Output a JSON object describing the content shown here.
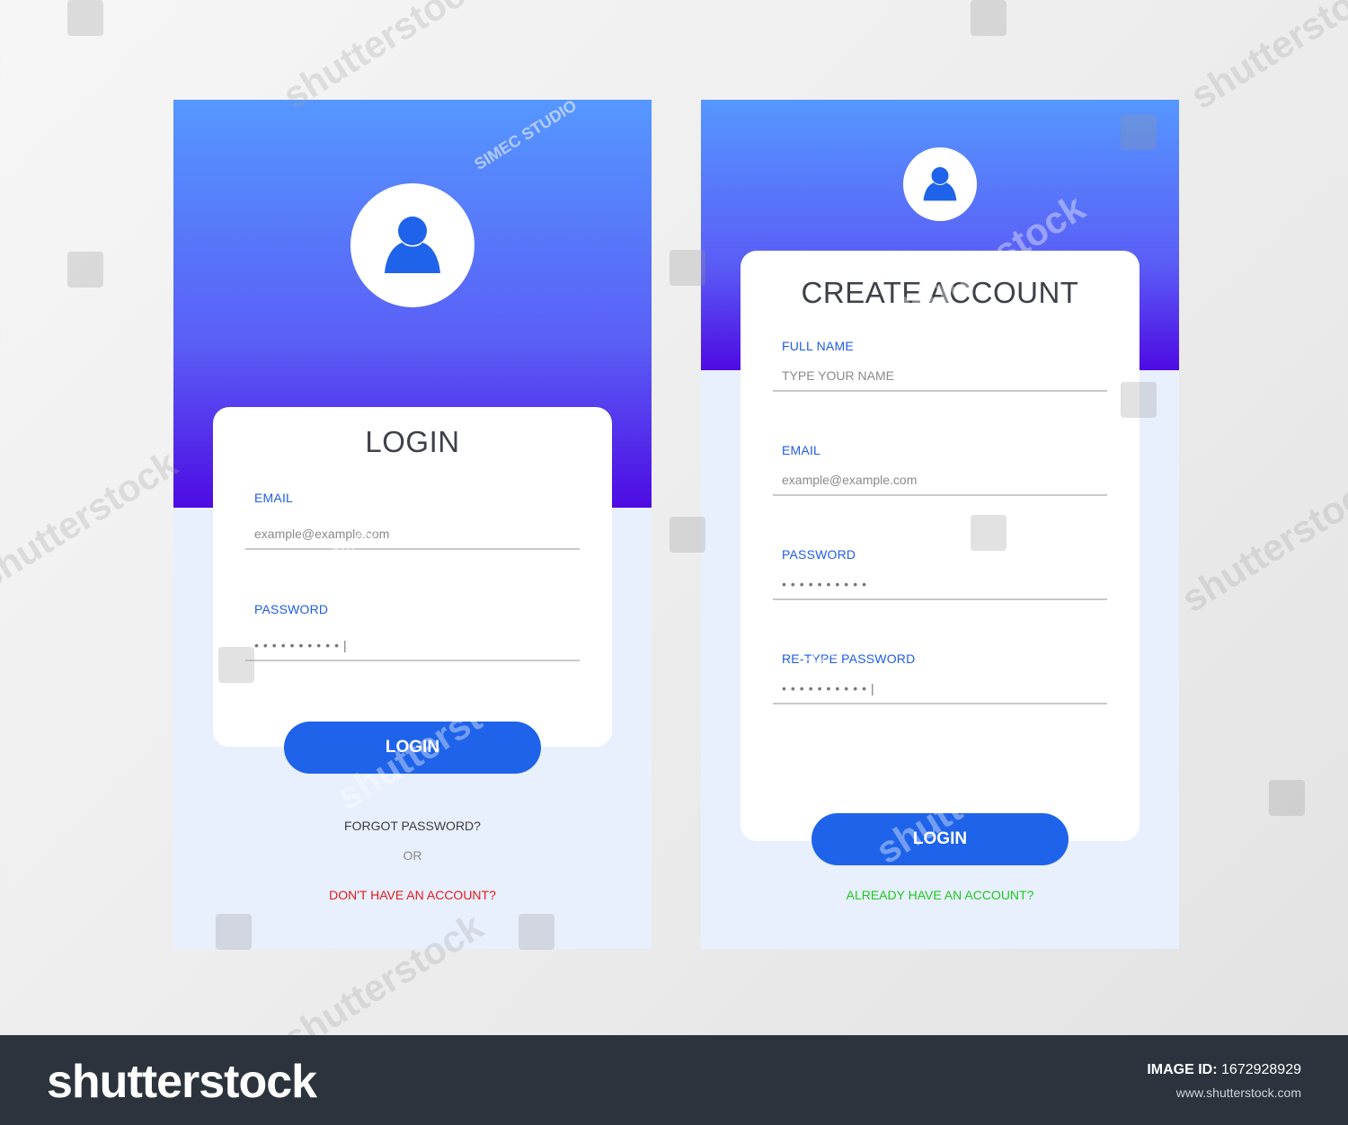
{
  "login_screen": {
    "title": "LOGIN",
    "email_label": "EMAIL",
    "email_placeholder": "example@example.com",
    "password_label": "PASSWORD",
    "password_value": "••••••••••|",
    "login_button": "LOGIN",
    "forgot_password": "FORGOT PASSWORD?",
    "or_text": "OR",
    "no_account": "DON'T HAVE AN ACCOUNT?"
  },
  "signup_screen": {
    "title": "CREATE ACCOUNT",
    "fullname_label": "FULL NAME",
    "fullname_placeholder": "TYPE YOUR NAME",
    "email_label": "EMAIL",
    "email_placeholder": "example@example.com",
    "password_label": "PASSWORD",
    "password_value": "••••••••••",
    "retype_label": "RE-TYPE PASSWORD",
    "retype_value": "••••••••••|",
    "login_button": "LOGIN",
    "have_account": "ALREADY HAVE AN ACCOUNT?"
  },
  "icons": {
    "avatar": "user-icon"
  },
  "colors": {
    "gradient_top": "#5597ff",
    "gradient_bottom": "#4e0be3",
    "panel_background": "#e8effd",
    "accent_blue": "#1e63ea",
    "label_blue": "#1f5ce6",
    "no_account_red": "#e01b1b",
    "have_account_green": "#1ec81e"
  },
  "watermark": {
    "brand": "shutterstock",
    "studio": "SIMEC STUDIO",
    "image_id_label": "IMAGE ID:",
    "image_id": "1672928929",
    "url": "www.shutterstock.com"
  }
}
